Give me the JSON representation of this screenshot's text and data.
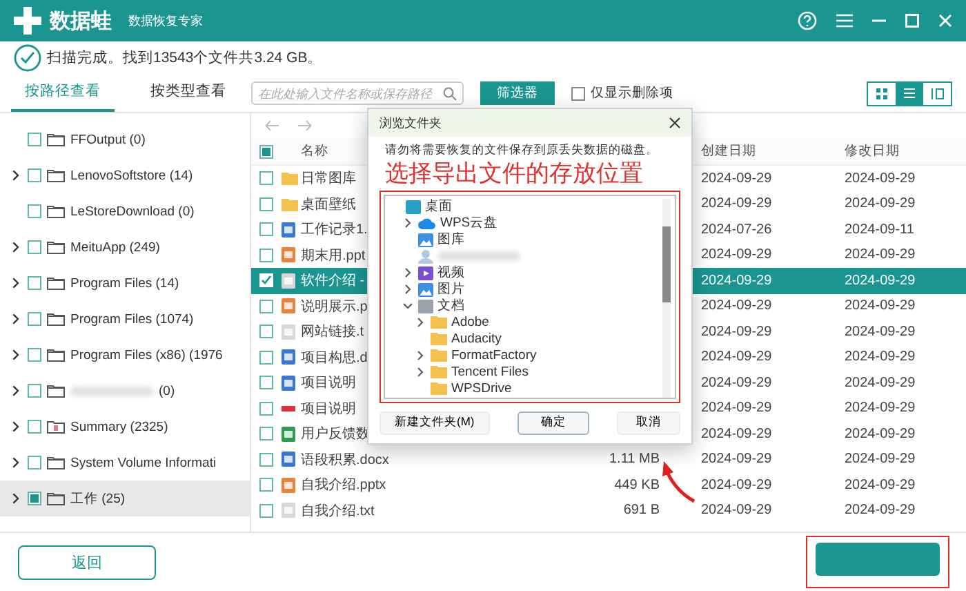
{
  "app": {
    "name": "数据蛙",
    "subtitle": "数据恢复专家"
  },
  "status": "扫描完成。找到13543个文件共3.24 GB。",
  "view_tabs": [
    {
      "label": "按路径查看",
      "selected": true
    },
    {
      "label": "按类型查看",
      "selected": false
    }
  ],
  "search": {
    "placeholder": "在此处输入文件名称或保存路径"
  },
  "filter_button": "筛选器",
  "deleted_only": {
    "label": "仅显示删除项",
    "checked": false
  },
  "view_modes": [
    {
      "kind": "grid",
      "selected": false
    },
    {
      "kind": "list",
      "selected": true
    },
    {
      "kind": "columns",
      "selected": false
    }
  ],
  "sidebar": {
    "items": [
      {
        "label": "FFOutput (0)",
        "kind": "folder",
        "expandable": false,
        "checked": false,
        "partial": false,
        "selected": false
      },
      {
        "label": "LenovoSoftstore (14)",
        "kind": "folder",
        "expandable": true,
        "checked": false,
        "partial": false,
        "selected": false
      },
      {
        "label": "LeStoreDownload (0)",
        "kind": "folder",
        "expandable": false,
        "checked": false,
        "partial": false,
        "selected": false
      },
      {
        "label": "MeituApp (249)",
        "kind": "folder",
        "expandable": true,
        "checked": false,
        "partial": false,
        "selected": false
      },
      {
        "label": "Program Files (14)",
        "kind": "folder",
        "expandable": true,
        "checked": false,
        "partial": false,
        "selected": false
      },
      {
        "label": "Program Files (1074)",
        "kind": "folder",
        "expandable": true,
        "checked": false,
        "partial": false,
        "selected": false
      },
      {
        "label": "Program Files (x86) (1976",
        "kind": "folder",
        "expandable": true,
        "checked": false,
        "partial": false,
        "selected": false
      },
      {
        "label": "(0)",
        "kind": "folder",
        "redacted": true,
        "expandable": true,
        "checked": false,
        "partial": false,
        "selected": false
      },
      {
        "label": "Summary (2325)",
        "kind": "special",
        "expandable": true,
        "checked": false,
        "partial": false,
        "selected": false
      },
      {
        "label": "System Volume Informati",
        "kind": "folder",
        "expandable": true,
        "checked": false,
        "partial": false,
        "selected": false
      },
      {
        "label": "工作 (25)",
        "kind": "folder",
        "expandable": true,
        "checked": false,
        "partial": true,
        "selected": true
      }
    ]
  },
  "table": {
    "header_partial": true,
    "columns": [
      "名称",
      "创建日期",
      "修改日期"
    ],
    "rows": [
      {
        "kind": "folder",
        "name": "日常图库",
        "created": "2024-09-29",
        "modified": "2024-09-29",
        "checked": false,
        "selected": false
      },
      {
        "kind": "folder",
        "name": "桌面壁纸",
        "created": "2024-09-29",
        "modified": "2024-09-29",
        "checked": false,
        "selected": false
      },
      {
        "kind": "doc",
        "name": "工作记录1.",
        "created": "2024-07-26",
        "modified": "2024-09-11",
        "checked": false,
        "selected": false
      },
      {
        "kind": "ppt",
        "name": "期末用.ppt",
        "created": "2024-09-29",
        "modified": "2024-09-29",
        "checked": false,
        "selected": false
      },
      {
        "kind": "txt",
        "name": "软件介绍 -",
        "created": "2024-09-29",
        "modified": "2024-09-29",
        "checked": true,
        "selected": true
      },
      {
        "kind": "ppt",
        "name": "说明展示.p",
        "created": "2024-09-29",
        "modified": "2024-09-29",
        "checked": false,
        "selected": false
      },
      {
        "kind": "txt",
        "name": "网站链接.t",
        "created": "2024-09-29",
        "modified": "2024-09-29",
        "checked": false,
        "selected": false
      },
      {
        "kind": "doc",
        "name": "项目构思.d",
        "created": "2024-09-29",
        "modified": "2024-09-29",
        "checked": false,
        "selected": false
      },
      {
        "kind": "doc",
        "name": "项目说明",
        "created": "2024-09-29",
        "modified": "2024-09-29",
        "checked": false,
        "selected": false
      },
      {
        "kind": "pdf",
        "name": "项目说明",
        "created": "2024-09-29",
        "modified": "2024-09-29",
        "checked": false,
        "selected": false
      },
      {
        "kind": "xls",
        "name": "用户反馈数",
        "created": "2024-09-29",
        "modified": "2024-09-29",
        "checked": false,
        "selected": false
      },
      {
        "kind": "doc",
        "name": "语段积累.docx",
        "size": "1.11 MB",
        "created": "2024-09-29",
        "modified": "2024-09-29",
        "checked": false,
        "selected": false
      },
      {
        "kind": "ppt",
        "name": "自我介绍.pptx",
        "size": "449 KB",
        "created": "2024-09-29",
        "modified": "2024-09-29",
        "checked": false,
        "selected": false
      },
      {
        "kind": "txt",
        "name": "自我介绍.txt",
        "size": "691 B",
        "created": "2024-09-29",
        "modified": "2024-09-29",
        "checked": false,
        "selected": false
      }
    ]
  },
  "dialog": {
    "title": "浏览文件夹",
    "note": "请勿将需要恢复的文件保存到原丢失数据的磁盘。",
    "annotation": "选择导出文件的存放位置",
    "tree": [
      {
        "label": "桌面",
        "kind": "desktop",
        "expandable": false,
        "children": [
          {
            "label": "WPS云盘",
            "kind": "cloud",
            "expandable": true,
            "expanded": false
          },
          {
            "label": "图库",
            "kind": "gallery",
            "expandable": false
          },
          {
            "kind": "user",
            "redacted": true,
            "expandable": false
          },
          {
            "label": "视频",
            "kind": "video",
            "expandable": true,
            "expanded": false
          },
          {
            "label": "图片",
            "kind": "gallery",
            "expandable": true,
            "expanded": false
          },
          {
            "label": "文档",
            "kind": "docs",
            "expandable": true,
            "expanded": true,
            "children": [
              {
                "label": "Adobe",
                "kind": "folder",
                "expandable": true,
                "expanded": false
              },
              {
                "label": "Audacity",
                "kind": "folder",
                "expandable": false
              },
              {
                "label": "FormatFactory",
                "kind": "folder",
                "expandable": true,
                "expanded": false
              },
              {
                "label": "Tencent Files",
                "kind": "folder",
                "expandable": true,
                "expanded": false
              },
              {
                "label": "WPSDrive",
                "kind": "folder",
                "expandable": false
              }
            ]
          }
        ]
      }
    ],
    "buttons": [
      {
        "label": "新建文件夹(M)",
        "default": false
      },
      {
        "label": "确定",
        "default": true
      },
      {
        "label": "取消",
        "default": false
      }
    ]
  },
  "back_button": "返回"
}
